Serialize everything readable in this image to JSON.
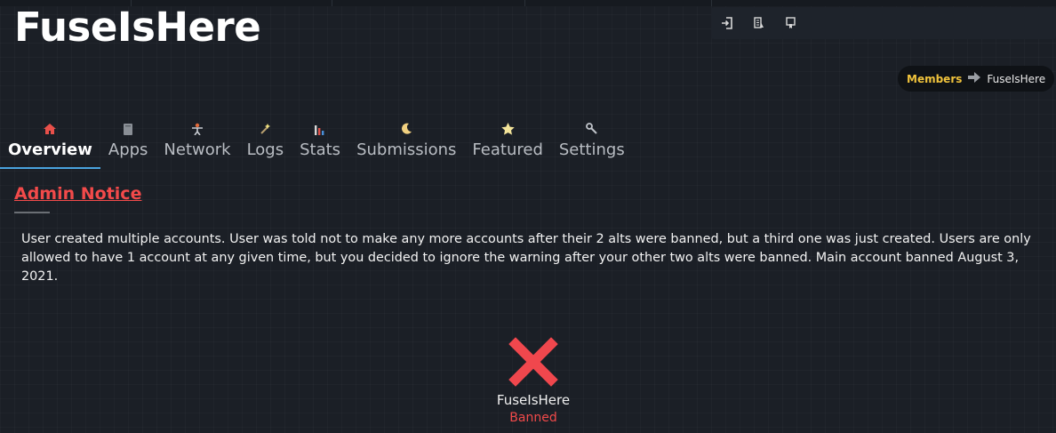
{
  "header": {
    "title": "FuseIsHere"
  },
  "actions": [
    {
      "icon": "sign-in-icon"
    },
    {
      "icon": "report-icon"
    },
    {
      "icon": "filter-icon"
    }
  ],
  "breadcrumb": {
    "parent": "Members",
    "current": "FuseIsHere"
  },
  "tabs": [
    {
      "label": "Overview",
      "icon": "home-icon",
      "active": true
    },
    {
      "label": "Apps",
      "icon": "book-icon"
    },
    {
      "label": "Network",
      "icon": "person-icon"
    },
    {
      "label": "Logs",
      "icon": "wand-icon"
    },
    {
      "label": "Stats",
      "icon": "bar-chart-icon"
    },
    {
      "label": "Submissions",
      "icon": "moon-icon"
    },
    {
      "label": "Featured",
      "icon": "star-icon"
    },
    {
      "label": "Settings",
      "icon": "wrench-icon"
    }
  ],
  "notice": {
    "title": "Admin Notice",
    "body": "User created multiple accounts. User was told not to make any more accounts after their 2 alts were banned, but a third one was just created. Users are only allowed to have 1 account at any given time, but you decided to ignore the warning after your other two alts were banned. Main account banned August 3, 2021."
  },
  "status": {
    "name": "FuseIsHere",
    "label": "Banned",
    "icon": "cross-icon"
  },
  "colors": {
    "background": "#1b1f26",
    "accent_red": "#f24a4a",
    "accent_gold": "#f0c33c",
    "tab_underline": "#4aa3df"
  }
}
